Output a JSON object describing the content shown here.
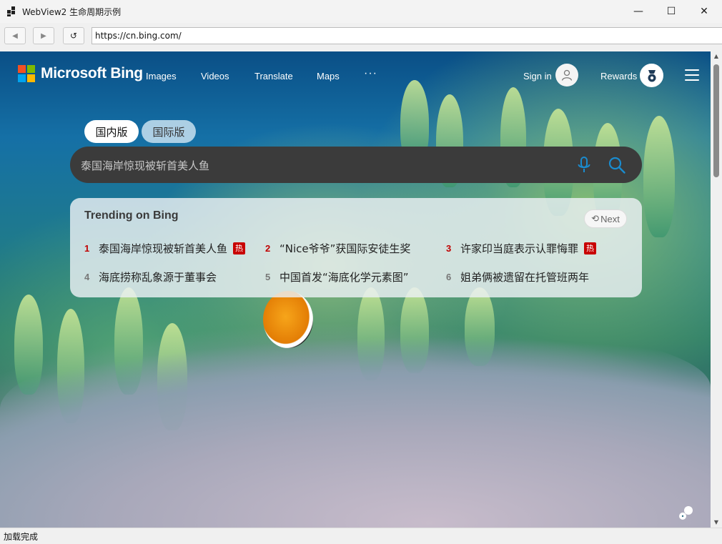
{
  "window": {
    "title": "WebView2 生命周期示例",
    "minimize_glyph": "—",
    "maximize_glyph": "☐",
    "close_glyph": "✕"
  },
  "navbar": {
    "back_glyph": "◀",
    "forward_glyph": "▶",
    "reload_glyph": "↺",
    "url": "https://cn.bing.com/"
  },
  "bing": {
    "logo_text": "Microsoft Bing",
    "nav": [
      "Images",
      "Videos",
      "Translate",
      "Maps"
    ],
    "more_glyph": "···",
    "sign_in": "Sign in",
    "rewards": "Rewards",
    "region_tabs": [
      "国内版",
      "国际版"
    ],
    "search_value": "泰国海岸惊现被斩首美人鱼",
    "trending_title": "Trending on Bing",
    "next_label": "Next",
    "next_glyph": "⟲",
    "hot_badge": "热",
    "trending": [
      {
        "rank": "1",
        "text": "泰国海岸惊现被斩首美人鱼",
        "hot": true
      },
      {
        "rank": "2",
        "text": "“Nice爷爷”获国际安徒生奖",
        "hot": false
      },
      {
        "rank": "3",
        "text": "许家印当庭表示认罪悔罪",
        "hot": true
      },
      {
        "rank": "4",
        "text": "海底捞称乱象源于董事会",
        "hot": false
      },
      {
        "rank": "5",
        "text": "中国首发“海底化学元素图”",
        "hot": false
      },
      {
        "rank": "6",
        "text": "姐弟俩被遗留在托管班两年",
        "hot": false
      }
    ],
    "colors": {
      "ms_red": "#f25022",
      "ms_green": "#7fba00",
      "ms_blue": "#00a4ef",
      "ms_yellow": "#ffb900",
      "hot_rank": "#c00000",
      "search_accent": "#1a8ccf"
    }
  },
  "scrollbar": {
    "up_glyph": "▲",
    "down_glyph": "▼"
  },
  "status": {
    "text": "加载完成"
  }
}
